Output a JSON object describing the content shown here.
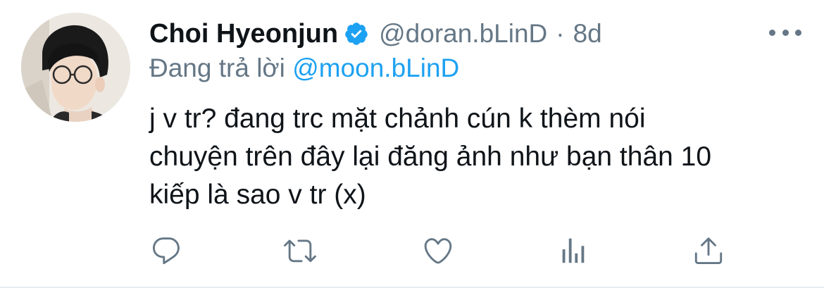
{
  "tweet": {
    "author": {
      "name": "Choi Hyeonjun",
      "handle": "@doran.bLinD",
      "verified": true
    },
    "separator": "·",
    "time": "8d",
    "reply_to": {
      "prefix": "Đang trả lời",
      "mention": "@moon.bLinD"
    },
    "text_lines": [
      "j v tr? đang trc mặt chảnh cún k thèm nói",
      "chuyện trên đây lại đăng ảnh như bạn thân 10",
      "kiếp là sao v tr (x)"
    ],
    "actions": [
      "reply-icon",
      "retweet-icon",
      "like-icon",
      "analytics-icon",
      "share-icon"
    ]
  },
  "colors": {
    "text": "#0f1419",
    "secondary": "#657786",
    "accent": "#1da1f2"
  }
}
